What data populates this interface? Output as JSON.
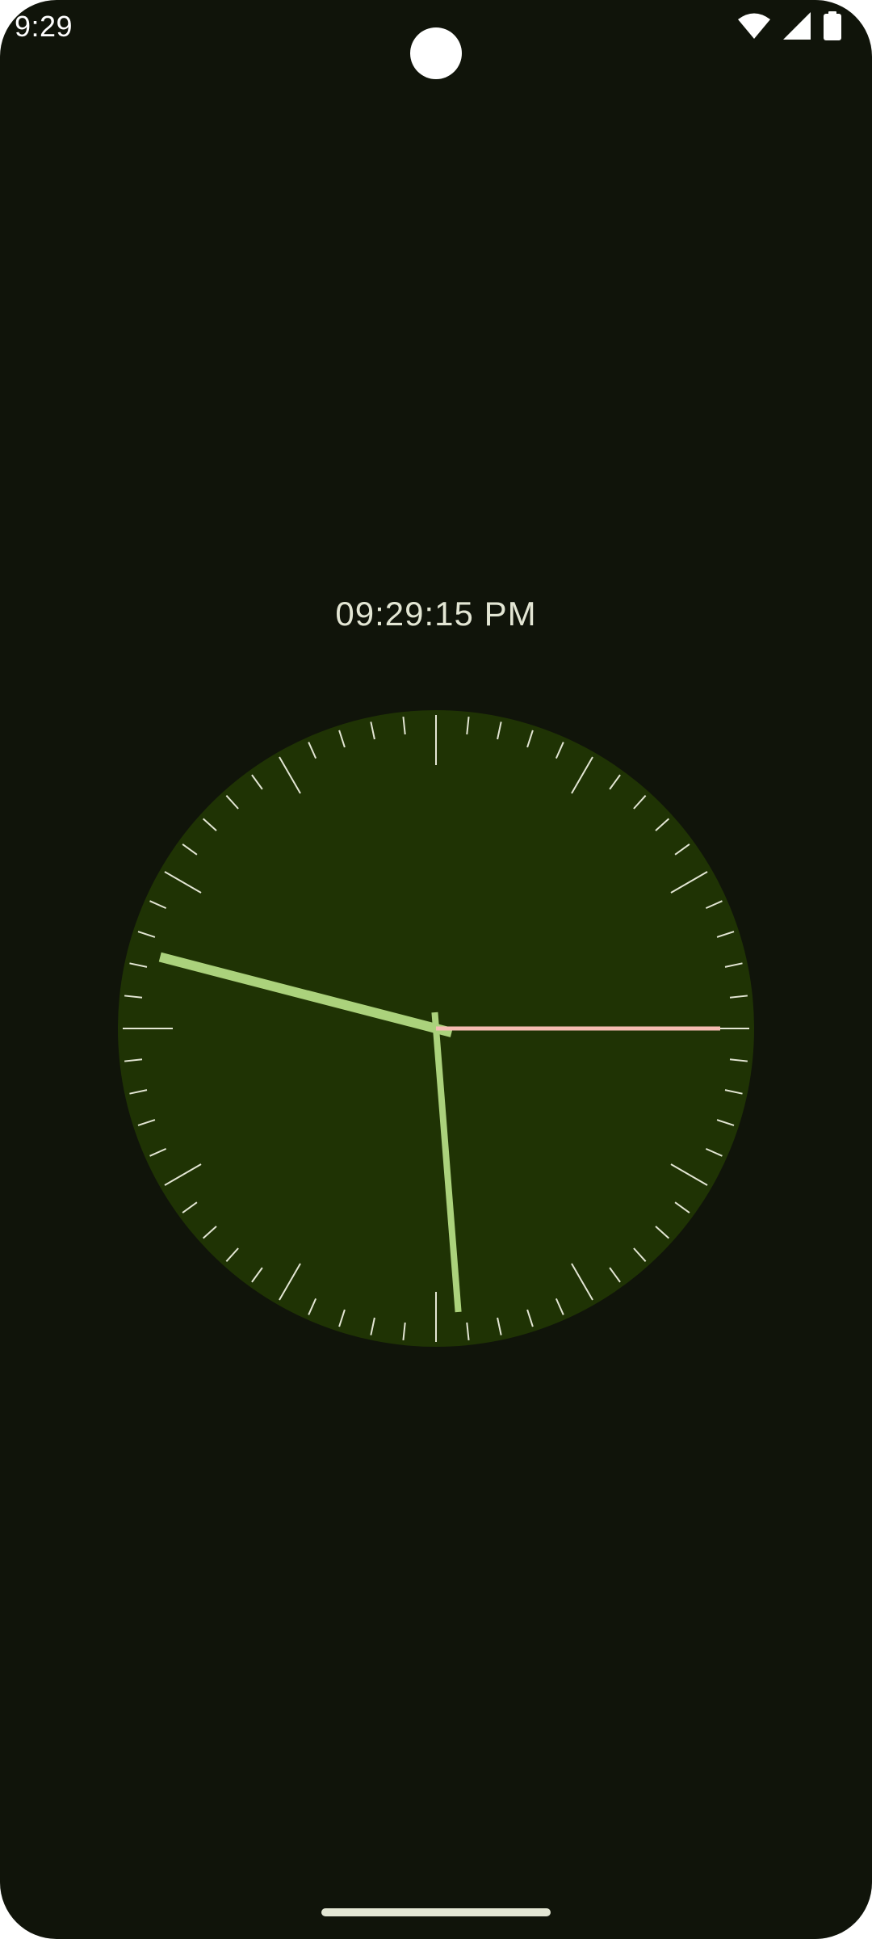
{
  "status_bar": {
    "time": "9:29",
    "icons": [
      "wifi-icon",
      "cell-signal-icon",
      "battery-icon"
    ]
  },
  "clock": {
    "digital_time": "09:29:15 PM",
    "hour": 9,
    "minute": 29,
    "second": 15,
    "colors": {
      "background": "#10140a",
      "face": "#1f3304",
      "ticks": "#e3e6d4",
      "hour_minute_hands": "#abd27c",
      "second_hand": "#f5bdb3"
    }
  }
}
